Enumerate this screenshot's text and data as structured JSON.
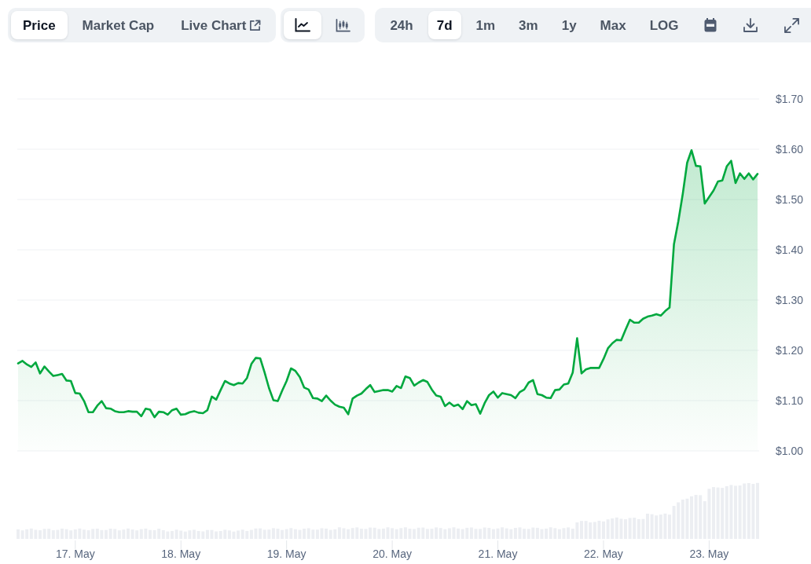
{
  "tabs": [
    {
      "kind": "tab",
      "label": "Price",
      "selected": true
    },
    {
      "kind": "tab",
      "label": "Market Cap",
      "selected": false
    },
    {
      "kind": "link",
      "label": "Live Chart",
      "selected": false
    }
  ],
  "chart_types": [
    {
      "kind": "line",
      "selected": true
    },
    {
      "kind": "candlestick",
      "selected": false
    }
  ],
  "ranges": [
    {
      "label": "24h",
      "selected": false
    },
    {
      "label": "7d",
      "selected": true
    },
    {
      "label": "1m",
      "selected": false
    },
    {
      "label": "3m",
      "selected": false
    },
    {
      "label": "1y",
      "selected": false
    },
    {
      "label": "Max",
      "selected": false
    }
  ],
  "log_scale": {
    "label": "LOG",
    "on": false
  },
  "chart": {
    "chart_data": {
      "type": "area",
      "grid": true,
      "series": [
        {
          "color": "#00a83e",
          "values": [
            1.174,
            1.179,
            1.172,
            1.167,
            1.176,
            1.154,
            1.168,
            1.158,
            1.149,
            1.151,
            1.153,
            1.14,
            1.139,
            1.115,
            1.114,
            1.099,
            1.077,
            1.077,
            1.09,
            1.099,
            1.085,
            1.084,
            1.079,
            1.077,
            1.077,
            1.079,
            1.078,
            1.078,
            1.069,
            1.084,
            1.082,
            1.067,
            1.078,
            1.077,
            1.072,
            1.081,
            1.084,
            1.072,
            1.073,
            1.077,
            1.079,
            1.076,
            1.075,
            1.081,
            1.108,
            1.102,
            1.121,
            1.139,
            1.134,
            1.131,
            1.135,
            1.134,
            1.145,
            1.173,
            1.185,
            1.184,
            1.156,
            1.125,
            1.101,
            1.099,
            1.12,
            1.139,
            1.164,
            1.159,
            1.147,
            1.126,
            1.122,
            1.105,
            1.104,
            1.099,
            1.11,
            1.1,
            1.092,
            1.088,
            1.086,
            1.073,
            1.104,
            1.11,
            1.114,
            1.123,
            1.131,
            1.117,
            1.119,
            1.121,
            1.121,
            1.118,
            1.129,
            1.125,
            1.148,
            1.145,
            1.13,
            1.136,
            1.141,
            1.137,
            1.122,
            1.11,
            1.108,
            1.089,
            1.096,
            1.089,
            1.092,
            1.083,
            1.099,
            1.091,
            1.093,
            1.074,
            1.095,
            1.111,
            1.118,
            1.106,
            1.115,
            1.113,
            1.111,
            1.105,
            1.117,
            1.122,
            1.136,
            1.141,
            1.113,
            1.111,
            1.106,
            1.105,
            1.121,
            1.122,
            1.132,
            1.134,
            1.156,
            1.224,
            1.154,
            1.162,
            1.165,
            1.165,
            1.165,
            1.183,
            1.204,
            1.214,
            1.221,
            1.22,
            1.241,
            1.261,
            1.255,
            1.255,
            1.263,
            1.267,
            1.269,
            1.272,
            1.269,
            1.278,
            1.285,
            1.411,
            1.457,
            1.511,
            1.573,
            1.598,
            1.567,
            1.566,
            1.492,
            1.505,
            1.518,
            1.536,
            1.538,
            1.566,
            1.577,
            1.533,
            1.552,
            1.541,
            1.552,
            1.54,
            1.551
          ]
        }
      ],
      "ylim": [
        1.0,
        1.7
      ],
      "yticks": [
        {
          "value": 1.0,
          "label": "$1.00"
        },
        {
          "value": 1.1,
          "label": "$1.10"
        },
        {
          "value": 1.2,
          "label": "$1.20"
        },
        {
          "value": 1.3,
          "label": "$1.30"
        },
        {
          "value": 1.4,
          "label": "$1.40"
        },
        {
          "value": 1.5,
          "label": "$1.50"
        },
        {
          "value": 1.6,
          "label": "$1.60"
        },
        {
          "value": 1.7,
          "label": "$1.70"
        }
      ]
    },
    "date_axis": [
      "17. May",
      "18. May",
      "19. May",
      "20. May",
      "21. May",
      "22. May",
      "23. May"
    ]
  }
}
